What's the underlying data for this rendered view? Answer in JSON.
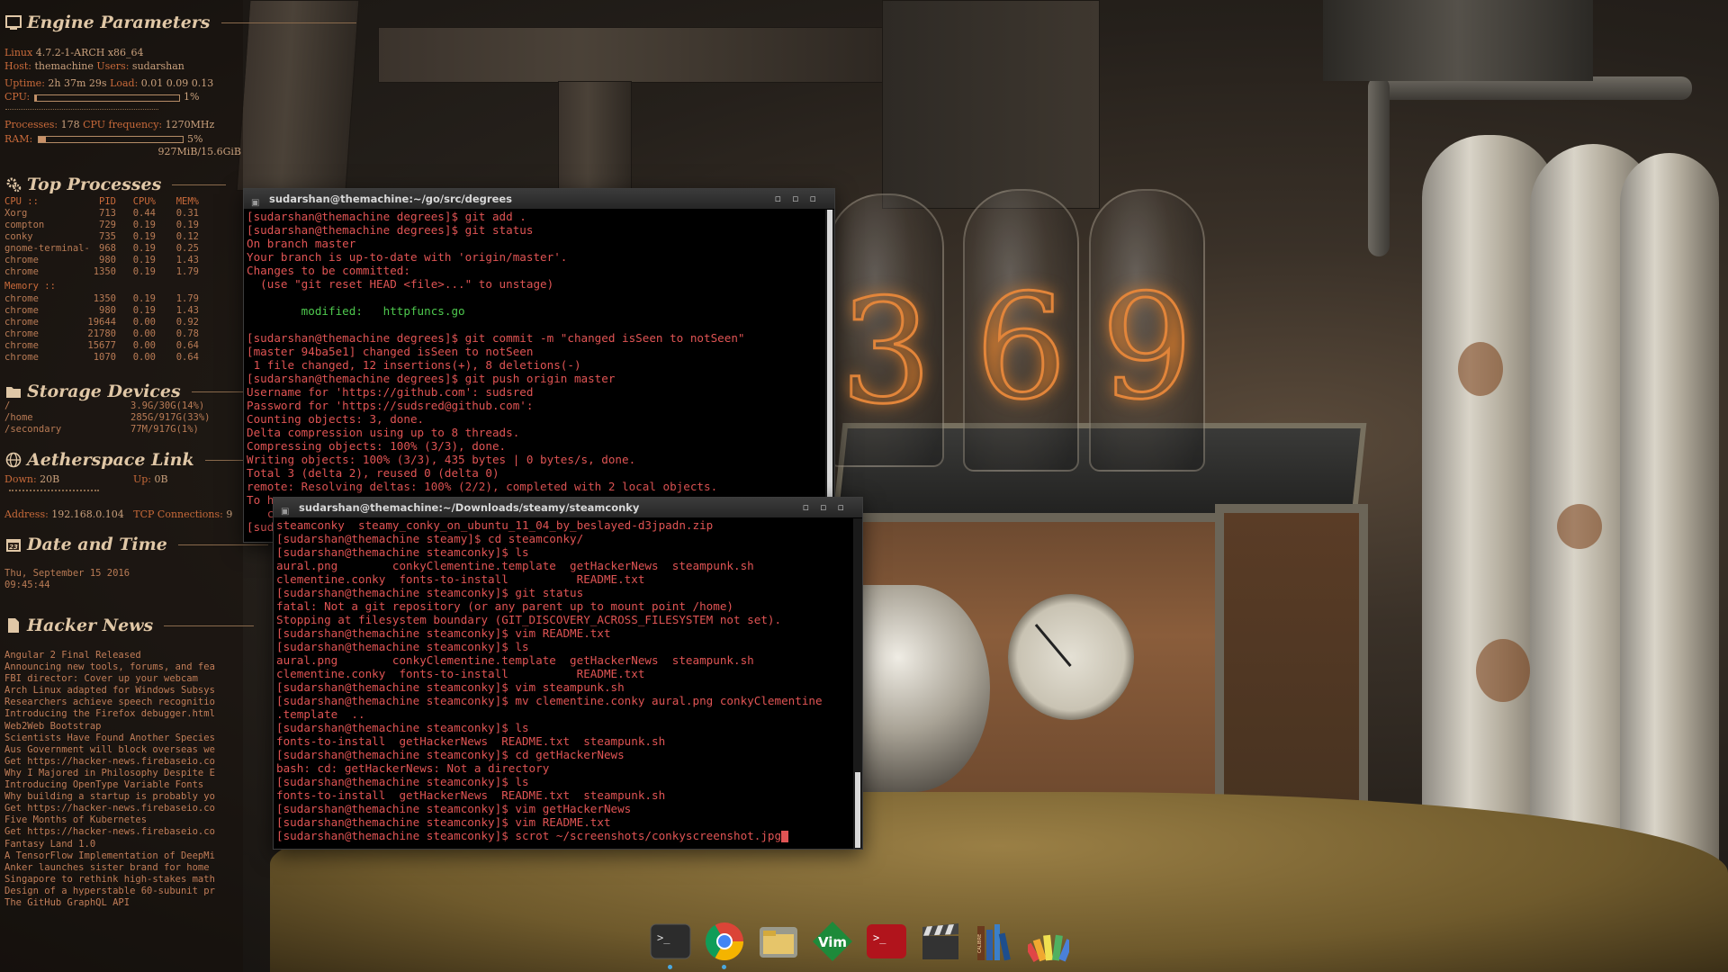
{
  "conky": {
    "engine": {
      "title": "Engine Parameters",
      "kernel_label": "Linux",
      "kernel": "4.7.2-1-ARCH x86_64",
      "host_label": "Host:",
      "host": "themachine",
      "users_label": "Users:",
      "users": "sudarshan",
      "uptime_label": "Uptime:",
      "uptime": "2h 37m 29s",
      "load_label": "Load:",
      "load": "0.01 0.09 0.13",
      "cpu_label": "CPU:",
      "cpu_pct": "1%",
      "cpu_fraction": 0.01,
      "processes_label": "Processes:",
      "processes": "178",
      "freq_label": "CPU frequency:",
      "freq": "1270MHz",
      "ram_label": "RAM:",
      "ram_pct": "5%",
      "ram_fraction": 0.05,
      "ram_usage": "927MiB/15.6GiB"
    },
    "top": {
      "title": "Top Processes",
      "cpu_header": "CPU ::",
      "col_pid": "PID",
      "col_cpu": "CPU%",
      "col_mem": "MEM%",
      "cpu_rows": [
        [
          "Xorg",
          "713",
          "0.44",
          "0.31"
        ],
        [
          "compton",
          "729",
          "0.19",
          "0.19"
        ],
        [
          "conky",
          "735",
          "0.19",
          "0.12"
        ],
        [
          "gnome-terminal-",
          "968",
          "0.19",
          "0.25"
        ],
        [
          "chrome",
          "980",
          "0.19",
          "1.43"
        ],
        [
          "chrome",
          "1350",
          "0.19",
          "1.79"
        ]
      ],
      "mem_header": "Memory ::",
      "mem_rows": [
        [
          "chrome",
          "1350",
          "0.19",
          "1.79"
        ],
        [
          "chrome",
          "980",
          "0.19",
          "1.43"
        ],
        [
          "chrome",
          "19644",
          "0.00",
          "0.92"
        ],
        [
          "chrome",
          "21780",
          "0.00",
          "0.78"
        ],
        [
          "chrome",
          "15677",
          "0.00",
          "0.64"
        ],
        [
          "chrome",
          "1070",
          "0.00",
          "0.64"
        ]
      ]
    },
    "storage": {
      "title": "Storage Devices",
      "rows": [
        [
          "/",
          "3.9G/30G(14%)"
        ],
        [
          "/home",
          "285G/917G(33%)"
        ],
        [
          "/secondary",
          "77M/917G(1%)"
        ]
      ]
    },
    "net": {
      "title": "Aetherspace Link",
      "down_label": "Down:",
      "down": "20B",
      "up_label": "Up:",
      "up": "0B",
      "address_label": "Address:",
      "address": "192.168.0.104",
      "tcp_label": "TCP Connections:",
      "tcp": "9"
    },
    "datetime": {
      "title": "Date and Time",
      "date": "Thu, September 15 2016",
      "time": "09:45:44"
    },
    "news": {
      "title": "Hacker News",
      "items": [
        "Angular 2 Final Released",
        "Announcing new tools, forums, and fea",
        "FBI director: Cover up your webcam",
        "Arch Linux adapted for Windows Subsys",
        "Researchers achieve speech recognitio",
        "Introducing the Firefox debugger.html",
        "Web2Web Bootstrap",
        "Scientists Have Found Another Species",
        "Aus Government will block overseas we",
        "Get https://hacker-news.firebaseio.co",
        "Why I Majored in Philosophy Despite E",
        "Introducing OpenType Variable Fonts",
        "Why building a startup is probably yo",
        "Get https://hacker-news.firebaseio.co",
        "Five Months of Kubernetes",
        "Get https://hacker-news.firebaseio.co",
        "Fantasy Land 1.0",
        "A TensorFlow Implementation of DeepMi",
        "Anker launches sister brand for home",
        "Singapore to rethink high-stakes math",
        "Design of a hyperstable 60-subunit pr",
        "The GitHub GraphQL API"
      ]
    }
  },
  "term1": {
    "title": "sudarshan@themachine:~/go/src/degrees",
    "lines": [
      "[sudarshan@themachine degrees]$ git add .",
      "[sudarshan@themachine degrees]$ git status",
      "On branch master",
      "Your branch is up-to-date with 'origin/master'.",
      "Changes to be committed:",
      "  (use \"git reset HEAD <file>...\" to unstage)",
      "",
      "\tmodified:   httpfuncs.go",
      "",
      "[sudarshan@themachine degrees]$ git commit -m \"changed isSeen to notSeen\"",
      "[master 94ba5e1] changed isSeen to notSeen",
      " 1 file changed, 12 insertions(+), 8 deletions(-)",
      "[sudarshan@themachine degrees]$ git push origin master",
      "Username for 'https://github.com': sudsred",
      "Password for 'https://sudsred@github.com':",
      "Counting objects: 3, done.",
      "Delta compression using up to 8 threads.",
      "Compressing objects: 100% (3/3), done.",
      "Writing objects: 100% (3/3), 435 bytes | 0 bytes/s, done.",
      "Total 3 (delta 2), reused 0 (delta 0)",
      "remote: Resolving deltas: 100% (2/2), completed with 2 local objects.",
      "To h",
      "   c",
      "[sud"
    ],
    "green_line": 7,
    "green_text": "httpfuncs.go"
  },
  "term2": {
    "title": "sudarshan@themachine:~/Downloads/steamy/steamconky",
    "lines": [
      "steamconky  steamy_conky_on_ubuntu_11_04_by_beslayed-d3jpadn.zip",
      "[sudarshan@themachine steamy]$ cd steamconky/",
      "[sudarshan@themachine steamconky]$ ls",
      "aural.png        conkyClementine.template  getHackerNews  steampunk.sh",
      "clementine.conky  fonts-to-install          README.txt",
      "[sudarshan@themachine steamconky]$ git status",
      "fatal: Not a git repository (or any parent up to mount point /home)",
      "Stopping at filesystem boundary (GIT_DISCOVERY_ACROSS_FILESYSTEM not set).",
      "[sudarshan@themachine steamconky]$ vim README.txt",
      "[sudarshan@themachine steamconky]$ ls",
      "aural.png        conkyClementine.template  getHackerNews  steampunk.sh",
      "clementine.conky  fonts-to-install          README.txt",
      "[sudarshan@themachine steamconky]$ vim steampunk.sh",
      "[sudarshan@themachine steamconky]$ mv clementine.conky aural.png conkyClementine",
      ".template  ..",
      "[sudarshan@themachine steamconky]$ ls",
      "fonts-to-install  getHackerNews  README.txt  steampunk.sh",
      "[sudarshan@themachine steamconky]$ cd getHackerNews",
      "bash: cd: getHackerNews: Not a directory",
      "[sudarshan@themachine steamconky]$ ls",
      "fonts-to-install  getHackerNews  README.txt  steampunk.sh",
      "[sudarshan@themachine steamconky]$ vim getHackerNews",
      "[sudarshan@themachine steamconky]$ vim README.txt",
      "[sudarshan@themachine steamconky]$ scrot ~/screenshots/conkyscreenshot.jpg"
    ]
  },
  "dock": {
    "items": [
      {
        "icon": "terminal-icon"
      },
      {
        "icon": "chrome-icon"
      },
      {
        "icon": "file-manager-icon"
      },
      {
        "icon": "vim-icon"
      },
      {
        "icon": "red-terminal-icon"
      },
      {
        "icon": "clapperboard-icon"
      },
      {
        "icon": "calibre-books-icon"
      },
      {
        "icon": "color-palette-icon"
      }
    ],
    "vim_label": "Vim",
    "calibre_label": "CALIBRE"
  },
  "colors": {
    "terminal_text": "#e05454",
    "terminal_green": "#4ec94e",
    "conky_accent": "#c96a3a",
    "conky_title": "#e0c7a6"
  }
}
